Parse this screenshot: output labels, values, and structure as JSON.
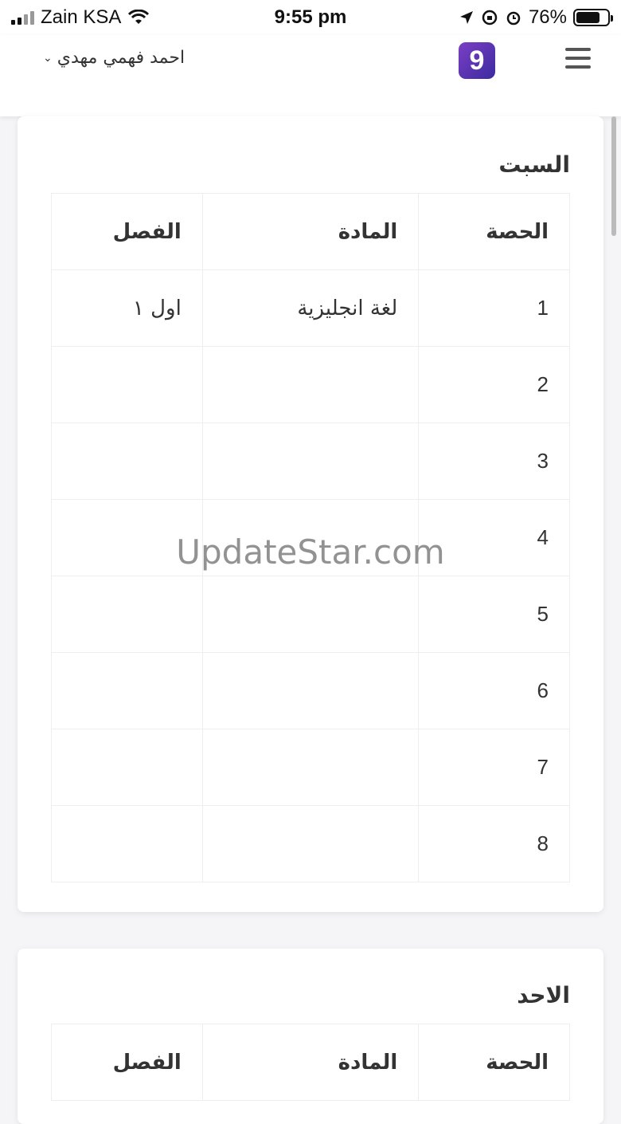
{
  "status": {
    "carrier": "Zain KSA",
    "time": "9:55 pm",
    "battery": "76%",
    "battery_level": 0.76
  },
  "header": {
    "user_name": "احمد فهمي مهدي",
    "logo_glyph": "9",
    "icons": {
      "menu": "hamburger-icon",
      "dropdown": "chevron-down-icon"
    }
  },
  "days": [
    {
      "title": "السبت",
      "headers": {
        "period": "الحصة",
        "subject": "المادة",
        "class": "الفصل"
      },
      "rows": [
        {
          "period": "1",
          "subject": "لغة انجليزية",
          "class": "اول ١"
        },
        {
          "period": "2",
          "subject": "",
          "class": ""
        },
        {
          "period": "3",
          "subject": "",
          "class": ""
        },
        {
          "period": "4",
          "subject": "",
          "class": ""
        },
        {
          "period": "5",
          "subject": "",
          "class": ""
        },
        {
          "period": "6",
          "subject": "",
          "class": ""
        },
        {
          "period": "7",
          "subject": "",
          "class": ""
        },
        {
          "period": "8",
          "subject": "",
          "class": ""
        }
      ]
    },
    {
      "title": "الاحد",
      "headers": {
        "period": "الحصة",
        "subject": "المادة",
        "class": "الفصل"
      }
    }
  ],
  "watermark": "UpdateStar.com"
}
